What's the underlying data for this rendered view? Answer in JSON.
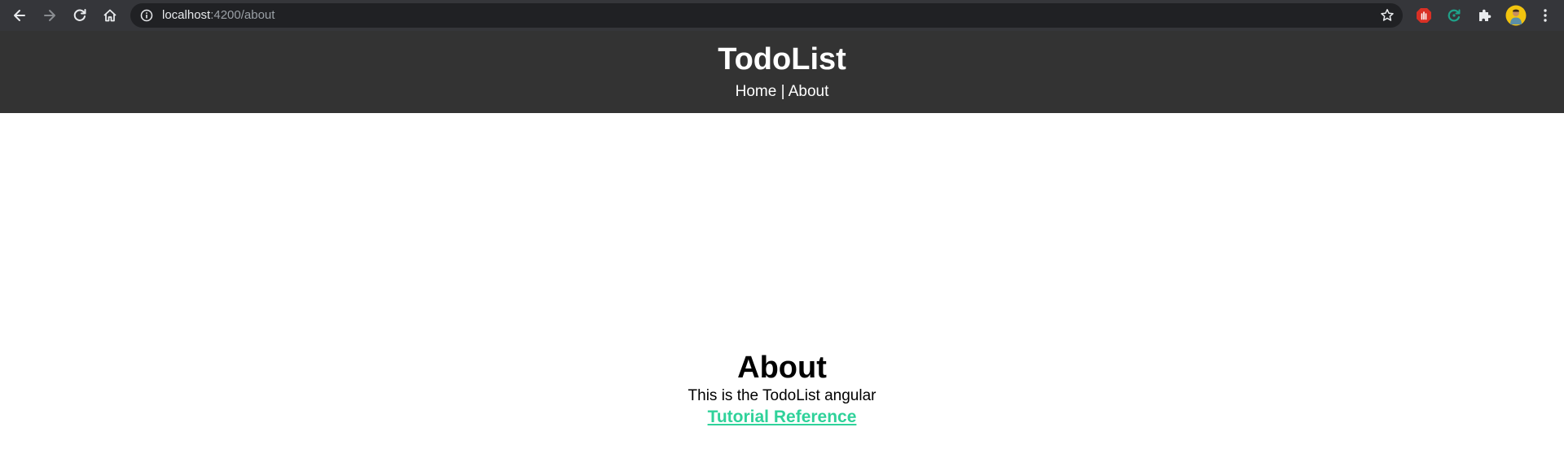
{
  "browser": {
    "url_host": "localhost",
    "url_rest": ":4200/about",
    "icons": [
      "back-icon",
      "forward-icon",
      "reload-icon",
      "home-icon",
      "info-icon",
      "star-icon",
      "ad-block-extension-icon",
      "sync-extension-icon",
      "extensions-puzzle-icon",
      "profile-avatar",
      "menu-dots-icon"
    ]
  },
  "header": {
    "title": "TodoList",
    "nav": {
      "home": "Home",
      "separator": "|",
      "about": "About"
    }
  },
  "main": {
    "heading": "About",
    "description": "This is the TodoList angular",
    "link": "Tutorial Reference",
    "link_color": "#2fd29a"
  },
  "colors": {
    "header_bg": "#333333",
    "browser_bar": "#35363a",
    "omnibox_bg": "#202124"
  }
}
